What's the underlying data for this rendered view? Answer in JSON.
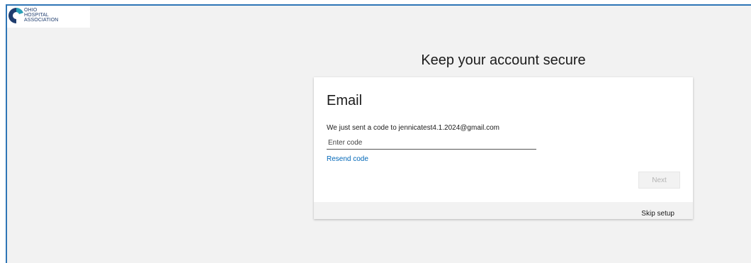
{
  "logo": {
    "line1": "OHIO",
    "line2": "HOSPITAL",
    "line3": "ASSOCIATION",
    "icon": "ohio-hospital-association-logo-icon"
  },
  "page": {
    "title": "Keep your account secure"
  },
  "card": {
    "heading": "Email",
    "message": "We just sent a code to jennicatest4.1.2024@gmail.com",
    "code_input": {
      "placeholder": "Enter code",
      "value": ""
    },
    "resend_label": "Resend code",
    "next_label": "Next",
    "skip_label": "Skip setup"
  },
  "colors": {
    "frame_border": "#2e75b6",
    "background": "#f2f2f2",
    "link": "#0067b8",
    "disabled_text": "#b3b3b3",
    "logo_navy": "#1f3d6e",
    "logo_teal": "#2a9fb6"
  }
}
